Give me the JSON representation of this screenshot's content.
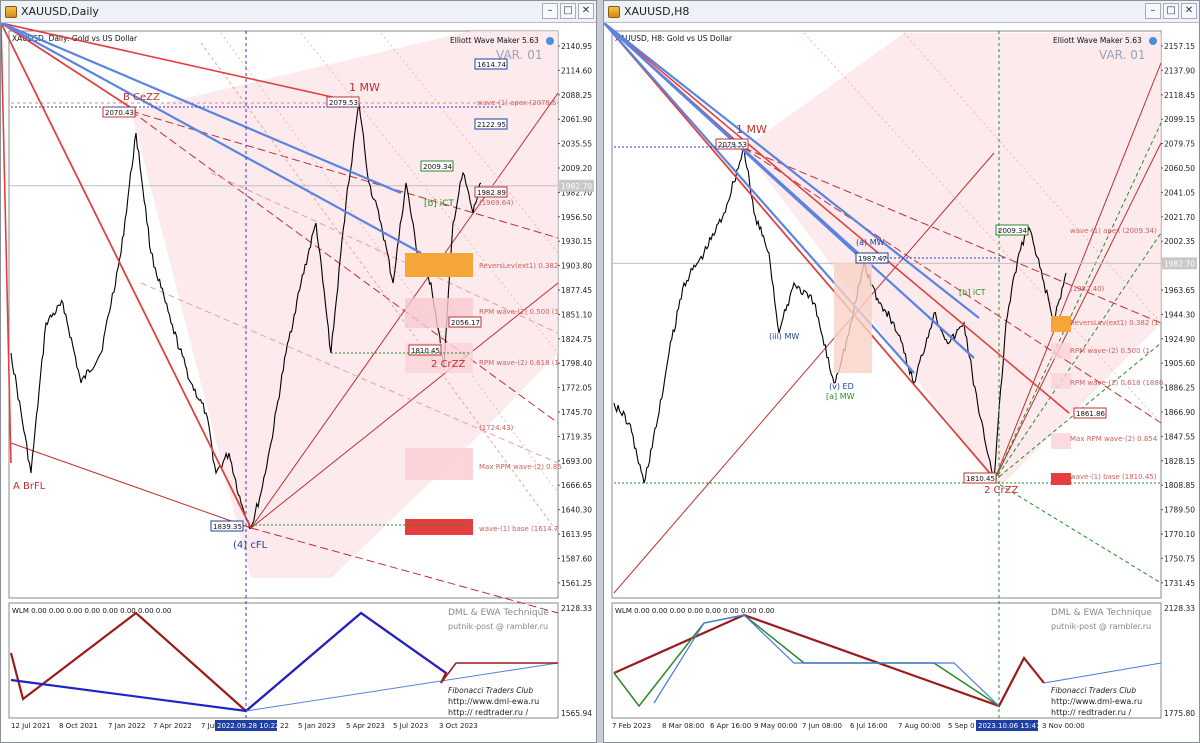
{
  "windows": [
    {
      "title": "XAUUSD,Daily",
      "header": "XAUUSD, Daily:  Gold vs US Dollar",
      "watermark": "Elliott Wave Maker 5.63",
      "var": "VAR. 01",
      "price_labels": [
        "2140.95",
        "2114.60",
        "2088.25",
        "2061.90",
        "2035.55",
        "2009.20",
        "1982.70",
        "1956.50",
        "1930.15",
        "1903.80",
        "1877.45",
        "1851.10",
        "1824.75",
        "1798.40",
        "1772.05",
        "1745.70",
        "1719.35",
        "1693.00",
        "1666.65",
        "1640.30",
        "1613.95",
        "1587.60",
        "1561.25"
      ],
      "ind_labels": [
        "2128.33",
        "1565.94"
      ],
      "date_labels": [
        "12 Jul 2021",
        "8 Oct 2021",
        "7 Jan 2022",
        "7 Apr 2022",
        "7 Jul",
        "2022.09.28 10:22",
        "22",
        "5 Jan 2023",
        "5 Apr 2023",
        "5 Jul 2023",
        "3 Oct 2023"
      ],
      "current_price": "1982.70",
      "wave_labels": {
        "bfl": "A BrFL",
        "bcezz": "B CeZZ",
        "mw": "1 MW",
        "crzz": "2 CrZZ",
        "cfl": "(4) cFL",
        "ict": "[b] iCT"
      },
      "boxes": [
        "2070.43",
        "2079.53",
        "2009.34",
        "1982.89",
        "1810.45",
        "1839.35",
        "1614.74",
        "2122.95",
        "2056.17"
      ],
      "annotations": [
        "wave-(1) apex (2079.5",
        "(1969.64)",
        "ReversLev(ext1) 0.382",
        "RPM wave-(2) 0.500 (1",
        "RPM wave-(2) 0.618 (1",
        "(1724.43)",
        "Max RPM wave-(2) 0.85",
        "wave-(1) base (1614.7"
      ],
      "indicator": {
        "label": "WLM 0.00 0.00 0.00 0.00 0.00 0.00 0.00 0.00",
        "brand1": "DML & EWA Technique",
        "brand2": "putnik-post @ rambler.ru",
        "brand3": "Fibonacci   Traders   Club",
        "url1": "http://www.dml-ewa.ru",
        "url2": "http:// redtrader.ru /"
      }
    },
    {
      "title": "XAUUSD,H8",
      "header": "XAUUSD, H8:  Gold vs US Dollar",
      "watermark": "Elliott Wave Maker 5.63",
      "var": "VAR. 01",
      "price_labels": [
        "2157.15",
        "2137.90",
        "2118.45",
        "2099.15",
        "2079.75",
        "2060.50",
        "2041.05",
        "2021.70",
        "2002.35",
        "1982.70",
        "1963.65",
        "1944.30",
        "1924.90",
        "1905.60",
        "1886.25",
        "1866.90",
        "1847.55",
        "1828.15",
        "1808.85",
        "1789.50",
        "1770.10",
        "1750.75",
        "1731.45"
      ],
      "ind_labels": [
        "2128.33",
        "1775.80"
      ],
      "date_labels": [
        "7 Feb 2023",
        "8 Mar 08:00",
        "6 Apr 16:00",
        "9 May 00:00",
        "7 Jun 08:00",
        "6 Jul 16:00",
        "7 Aug 00:00",
        "5 Sep 0",
        "2023.10.06 15:47",
        "3 Nov 00:00"
      ],
      "current_price": "1982.70",
      "wave_labels": {
        "mw": "1 MW",
        "crzz": "2 CrZZ",
        "ict": "[b] iCT",
        "amw": "(a) MW",
        "vmw": "(iii) MW",
        "ved": "(v) ED",
        "amw2": "[a] MW"
      },
      "boxes": [
        "2079.53",
        "1987.47",
        "2009.34",
        "1810.45",
        "1861.86"
      ],
      "annotations": [
        "wave-(1) apex (2009.34)",
        "(1982.40)",
        "ReversLev(ext1) 0.382 (1",
        "RPM wave-(2) 0.500 (1",
        "RPM wave-(2) 0.618 (1886",
        "Max RPM wave-(2) 0.854",
        "wave-(1) base (1810.45)"
      ],
      "indicator": {
        "label": "WLM 0.00 0.00 0.00 0.00 0.00 0.00 0.00 0.00",
        "brand1": "DML & EWA Technique",
        "brand2": "putnik-post @ rambler.ru",
        "brand3": "Fibonacci   Traders   Club",
        "url1": "http://www.dml-ewa.ru",
        "url2": "http:// redtrader.ru /"
      }
    }
  ],
  "chart_data": [
    {
      "type": "line",
      "title": "XAUUSD, Daily:  Gold vs US Dollar",
      "ylim": [
        1561.25,
        2140.95
      ],
      "x": [
        "2021-07",
        "2021-10",
        "2022-01",
        "2022-03",
        "2022-04",
        "2022-07",
        "2022-09",
        "2022-11",
        "2023-01",
        "2023-02",
        "2023-05",
        "2023-07",
        "2023-10",
        "2023-12"
      ],
      "series": [
        {
          "name": "",
          "values": [
            1705,
            1760,
            1810,
            2070,
            1930,
            1710,
            1614,
            1760,
            1930,
            1810,
            2079,
            1900,
            1810,
            2009
          ]
        }
      ]
    },
    {
      "type": "line",
      "title": "XAUUSD, H8:  Gold vs US Dollar",
      "ylim": [
        1731.45,
        2157.15
      ],
      "x": [
        "2023-02",
        "2023-02",
        "2023-03",
        "2023-04",
        "2023-05",
        "2023-06",
        "2023-07",
        "2023-08",
        "2023-09",
        "2023-10",
        "2023-10",
        "2023-11",
        "2023-11"
      ],
      "series": [
        {
          "name": "",
          "values": [
            1880,
            1810,
            1900,
            2000,
            2079,
            1940,
            1900,
            1987,
            1890,
            1930,
            1810,
            2009,
            1960
          ]
        }
      ]
    }
  ]
}
